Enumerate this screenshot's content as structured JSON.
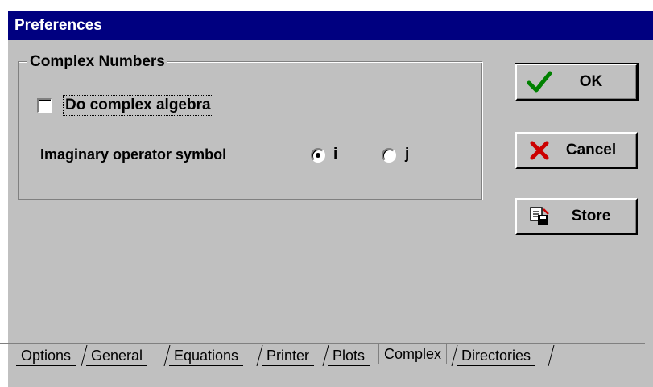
{
  "window": {
    "title": "Preferences"
  },
  "group": {
    "label": "Complex Numbers",
    "checkbox_label": "Do complex algebra",
    "checkbox_checked": false,
    "symbol_label": "Imaginary operator symbol",
    "options": [
      {
        "label": "i",
        "selected": true
      },
      {
        "label": "j",
        "selected": false
      }
    ]
  },
  "buttons": {
    "ok": "OK",
    "cancel": "Cancel",
    "store": "Store"
  },
  "tabs": [
    "Options",
    "General",
    "Equations",
    "Printer",
    "Plots",
    "Complex",
    "Directories"
  ],
  "active_tab": "Complex",
  "colors": {
    "titlebar": "#000080",
    "face": "#c0c0c0",
    "check_green": "#008000",
    "cancel_red": "#cc0000"
  }
}
